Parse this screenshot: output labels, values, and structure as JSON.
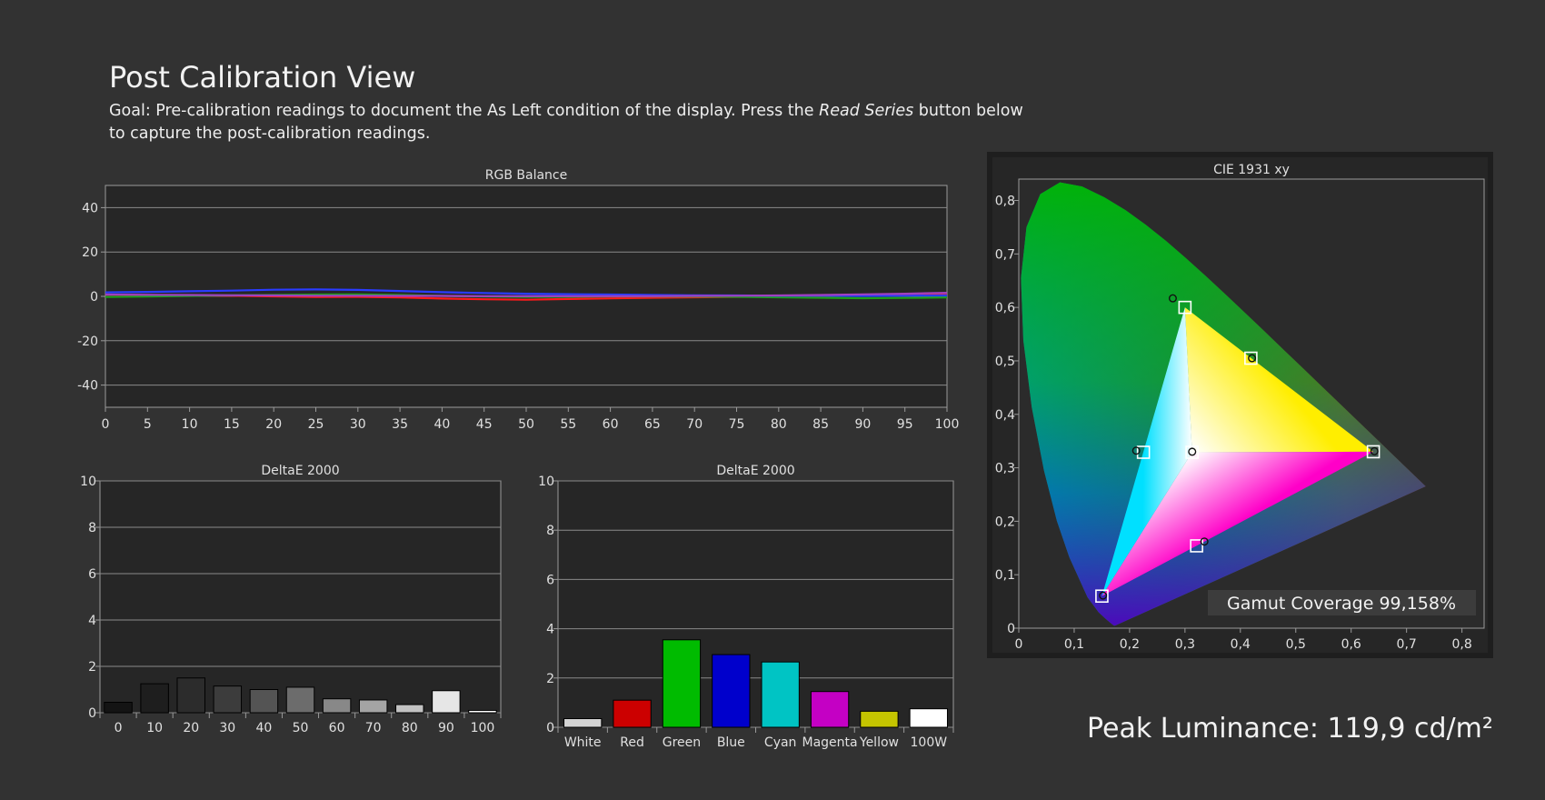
{
  "header": {
    "title": "Post Calibration View",
    "goal_prefix": "Goal: Pre-calibration readings to document the As Left condition of the display. Press the ",
    "goal_emphasis": "Read Series",
    "goal_suffix": " button below to capture the post-calibration readings."
  },
  "peak_luminance": "Peak Luminance: 119,9 cd/m²",
  "chart_data": [
    {
      "id": "rgb-balance",
      "type": "line",
      "title": "RGB Balance",
      "x": [
        0,
        5,
        10,
        15,
        20,
        25,
        30,
        35,
        40,
        45,
        50,
        55,
        60,
        65,
        70,
        75,
        80,
        85,
        90,
        95,
        100
      ],
      "xlim": [
        0,
        100
      ],
      "ylim": [
        -50,
        50
      ],
      "yticks": [
        40,
        20,
        0,
        -20,
        -40
      ],
      "xticks": [
        0,
        5,
        10,
        15,
        20,
        25,
        30,
        35,
        40,
        45,
        50,
        55,
        60,
        65,
        70,
        75,
        80,
        85,
        90,
        95,
        100
      ],
      "grid": true,
      "series": [
        {
          "color": "#ff1a1a",
          "values": [
            0.8,
            0.6,
            0.4,
            0.3,
            0,
            -0.3,
            -0.2,
            -0.5,
            -1,
            -1.3,
            -1.5,
            -1.2,
            -0.9,
            -0.6,
            -0.4,
            -0.2,
            0,
            0.2,
            0.5,
            0.9,
            1.3
          ]
        },
        {
          "color": "#1aa01a",
          "values": [
            -0.3,
            -0.1,
            0.2,
            0.5,
            0.6,
            0.8,
            0.9,
            0.6,
            0.2,
            -0.1,
            -0.3,
            -0.2,
            0,
            0,
            -0.1,
            -0.2,
            -0.4,
            -0.6,
            -0.8,
            -0.7,
            -0.5
          ]
        },
        {
          "color": "#2a3cff",
          "values": [
            1.8,
            2,
            2.3,
            2.6,
            3,
            3.1,
            2.9,
            2.4,
            1.9,
            1.5,
            1.2,
            1,
            0.8,
            0.6,
            0.5,
            0.4,
            0.3,
            0.3,
            0.2,
            0.3,
            0.4
          ]
        },
        {
          "color": "#a040c0",
          "values": [
            0.8,
            0.7,
            0.6,
            0.5,
            0.4,
            0.3,
            0.3,
            0.2,
            0.2,
            0.1,
            0.1,
            0.1,
            0.1,
            0.1,
            0.2,
            0.3,
            0.4,
            0.6,
            0.9,
            1.2,
            1.6
          ]
        }
      ]
    },
    {
      "id": "deltae-grayscale",
      "type": "bar",
      "title": "DeltaE 2000",
      "categories": [
        "0",
        "10",
        "20",
        "30",
        "40",
        "50",
        "60",
        "70",
        "80",
        "90",
        "100"
      ],
      "values": [
        0.45,
        1.25,
        1.5,
        1.15,
        1.0,
        1.1,
        0.6,
        0.55,
        0.35,
        0.95,
        0.1
      ],
      "colors": [
        "#141414",
        "#1e1e1e",
        "#2c2c2c",
        "#3c3c3c",
        "#545454",
        "#6c6c6c",
        "#888888",
        "#a4a4a4",
        "#c2c2c2",
        "#e6e6e6",
        "#ffffff"
      ],
      "ylim": [
        0,
        10
      ],
      "yticks": [
        0,
        2,
        4,
        6,
        8,
        10
      ],
      "grid": true
    },
    {
      "id": "deltae-colors",
      "type": "bar",
      "title": "DeltaE 2000",
      "categories": [
        "White",
        "Red",
        "Green",
        "Blue",
        "Cyan",
        "Magenta",
        "Yellow",
        "100W"
      ],
      "values": [
        0.35,
        1.1,
        3.55,
        2.95,
        2.65,
        1.45,
        0.65,
        0.75
      ],
      "colors": [
        "#d4d4d4",
        "#cc0000",
        "#00bb00",
        "#0000cc",
        "#00c4c4",
        "#c400c4",
        "#c4c400",
        "#ffffff"
      ],
      "ylim": [
        0,
        10
      ],
      "yticks": [
        0,
        2,
        4,
        6,
        8,
        10
      ],
      "grid": true
    },
    {
      "id": "cie-1931",
      "type": "scatter",
      "title": "CIE 1931 xy",
      "xlim": [
        0,
        0.84
      ],
      "ylim": [
        0,
        0.84
      ],
      "xticks": [
        "0",
        "0,1",
        "0,2",
        "0,3",
        "0,4",
        "0,5",
        "0,6",
        "0,7",
        "0,8"
      ],
      "yticks": [
        "0",
        "0,1",
        "0,2",
        "0,3",
        "0,4",
        "0,5",
        "0,6",
        "0,7",
        "0,8"
      ],
      "targets": [
        {
          "name": "Red",
          "x": 0.64,
          "y": 0.33
        },
        {
          "name": "Green",
          "x": 0.3,
          "y": 0.6
        },
        {
          "name": "Blue",
          "x": 0.15,
          "y": 0.06
        },
        {
          "name": "Yellow",
          "x": 0.419,
          "y": 0.505
        },
        {
          "name": "Cyan",
          "x": 0.225,
          "y": 0.329
        },
        {
          "name": "Magenta",
          "x": 0.321,
          "y": 0.154
        },
        {
          "name": "White",
          "x": 0.3127,
          "y": 0.329
        }
      ],
      "measured": [
        {
          "name": "Red",
          "x": 0.642,
          "y": 0.331
        },
        {
          "name": "Green",
          "x": 0.278,
          "y": 0.617
        },
        {
          "name": "Blue",
          "x": 0.152,
          "y": 0.061
        },
        {
          "name": "Yellow",
          "x": 0.421,
          "y": 0.505
        },
        {
          "name": "Cyan",
          "x": 0.212,
          "y": 0.332
        },
        {
          "name": "Magenta",
          "x": 0.335,
          "y": 0.162
        },
        {
          "name": "White",
          "x": 0.313,
          "y": 0.33
        }
      ],
      "gamut_coverage_label": "Gamut Coverage 99,158%"
    }
  ]
}
